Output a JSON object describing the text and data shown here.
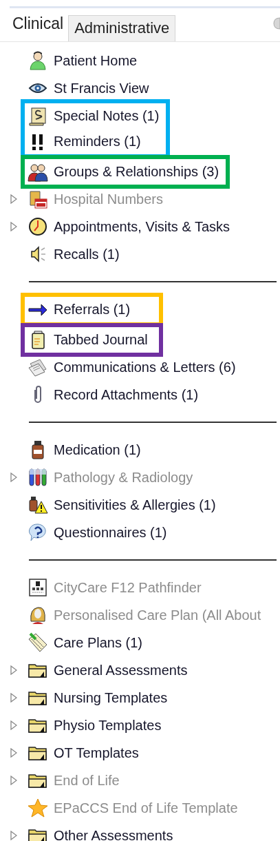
{
  "tabs": [
    {
      "label": "Clinical",
      "selected": true
    },
    {
      "label": "Administrative",
      "selected": false
    }
  ],
  "sections": [
    {
      "rows": [
        {
          "kind": "item",
          "label": "Patient Home",
          "expandable": false,
          "disabled": false
        },
        {
          "kind": "item",
          "label": "St Francis View",
          "expandable": false,
          "disabled": false
        },
        {
          "kind": "highlight",
          "color": "#00b0f0",
          "items": [
            {
              "label": "Special Notes (1)",
              "disabled": false
            },
            {
              "label": "Reminders (1)",
              "disabled": false
            }
          ]
        },
        {
          "kind": "highlight",
          "color": "#00b050",
          "items": [
            {
              "label": "Groups & Relationships (3)",
              "disabled": false
            }
          ]
        },
        {
          "kind": "item",
          "label": "Hospital Numbers",
          "expandable": true,
          "disabled": true
        },
        {
          "kind": "item",
          "label": "Appointments, Visits & Tasks",
          "expandable": true,
          "disabled": false
        },
        {
          "kind": "item",
          "label": "Recalls (1)",
          "expandable": false,
          "disabled": false
        }
      ]
    },
    {
      "rows": [
        {
          "kind": "highlight",
          "color": "#ffc000",
          "items": [
            {
              "label": "Referrals (1)",
              "disabled": false
            }
          ]
        },
        {
          "kind": "highlight",
          "color": "#7030a0",
          "items": [
            {
              "label": "Tabbed Journal",
              "disabled": false
            }
          ]
        },
        {
          "kind": "item",
          "label": "Communications & Letters (6)",
          "expandable": false,
          "disabled": false
        },
        {
          "kind": "item",
          "label": "Record Attachments (1)",
          "expandable": false,
          "disabled": false
        }
      ]
    },
    {
      "rows": [
        {
          "kind": "item",
          "label": "Medication (1)",
          "expandable": false,
          "disabled": false
        },
        {
          "kind": "item",
          "label": "Pathology & Radiology",
          "expandable": true,
          "disabled": true
        },
        {
          "kind": "item",
          "label": "Sensitivities & Allergies (1)",
          "expandable": false,
          "disabled": false
        },
        {
          "kind": "item",
          "label": "Questionnaires (1)",
          "expandable": false,
          "disabled": false
        }
      ]
    },
    {
      "rows": [
        {
          "kind": "item",
          "label": "CityCare F12 Pathfinder",
          "expandable": false,
          "disabled": true
        },
        {
          "kind": "item",
          "label": "Personalised Care Plan (All About",
          "expandable": false,
          "disabled": true
        },
        {
          "kind": "item",
          "label": "Care Plans (1)",
          "expandable": false,
          "disabled": false
        },
        {
          "kind": "item",
          "label": "General Assessments",
          "expandable": true,
          "disabled": false
        },
        {
          "kind": "item",
          "label": "Nursing Templates",
          "expandable": true,
          "disabled": false
        },
        {
          "kind": "item",
          "label": "Physio Templates",
          "expandable": true,
          "disabled": false
        },
        {
          "kind": "item",
          "label": "OT Templates",
          "expandable": true,
          "disabled": false
        },
        {
          "kind": "item",
          "label": "End of Life",
          "expandable": true,
          "disabled": true
        },
        {
          "kind": "item",
          "label": "EPaCCS End of Life Template",
          "expandable": false,
          "disabled": true
        },
        {
          "kind": "item",
          "label": "Other Assessments",
          "expandable": true,
          "disabled": false
        }
      ]
    }
  ]
}
